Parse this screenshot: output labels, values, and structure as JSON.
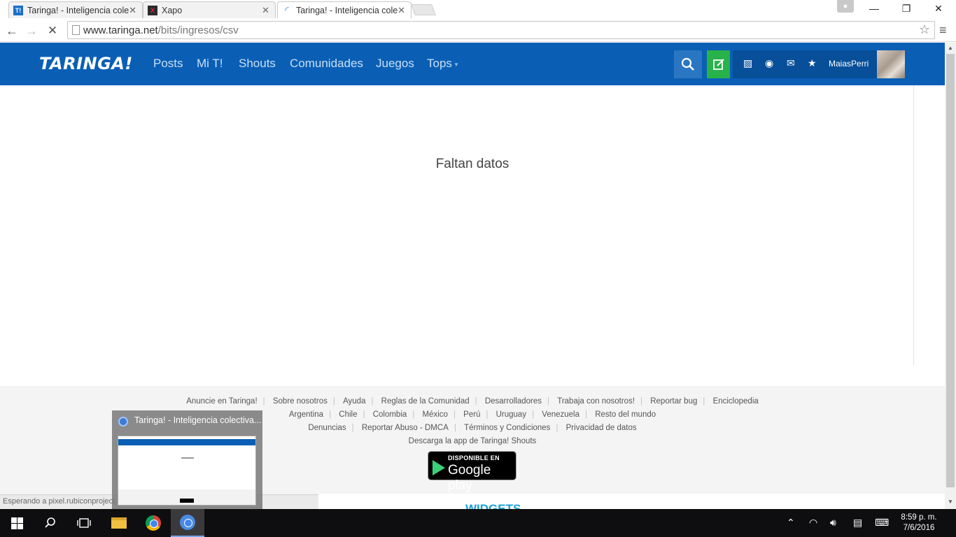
{
  "browser": {
    "tabs": [
      {
        "title": "Taringa! - Inteligencia cole",
        "favicon": "T!",
        "favicon_color": "#1a6fc9"
      },
      {
        "title": "Xapo",
        "favicon": "X",
        "favicon_color": "#2b2b2b"
      },
      {
        "title": "Taringa! - Inteligencia cole",
        "favicon": "",
        "active": true
      }
    ],
    "url_host": "www.taringa.net",
    "url_path": "/bits/ingresos/csv",
    "window_controls": {
      "minimize": "—",
      "restore": "❐",
      "close": "✕"
    }
  },
  "site": {
    "logo": "TARINGA!",
    "nav": [
      "Posts",
      "Mi T!",
      "Shouts",
      "Comunidades",
      "Juegos",
      "Tops"
    ],
    "username": "MaiasPerri",
    "colors": {
      "header_bg": "#0a5fb5",
      "post_button": "#27b24a"
    }
  },
  "main": {
    "message": "Faltan datos"
  },
  "footer": {
    "row1": [
      "Anuncie en Taringa!",
      "Sobre nosotros",
      "Ayuda",
      "Reglas de la Comunidad",
      "Desarrolladores",
      "Trabaja con nosotros!",
      "Reportar bug",
      "Enciclopedia"
    ],
    "row2": [
      "Argentina",
      "Chile",
      "Colombia",
      "México",
      "Perú",
      "Uruguay",
      "Venezuela",
      "Resto del mundo"
    ],
    "row3": [
      "Denuncias",
      "Reportar Abuso - DMCA",
      "Términos y Condiciones",
      "Privacidad de datos"
    ],
    "app_text": "Descarga la app de Taringa! Shouts",
    "gplay_small": "DISPONIBLE EN",
    "gplay_big": "Google play",
    "widgets": "WIDGETS"
  },
  "status_text": "Esperando a pixel.rubiconproject.com...",
  "thumbnail_title": "Taringa! - Inteligencia colectiva...",
  "taskbar": {
    "time": "8:59 p. m.",
    "date": "7/6/2016"
  }
}
